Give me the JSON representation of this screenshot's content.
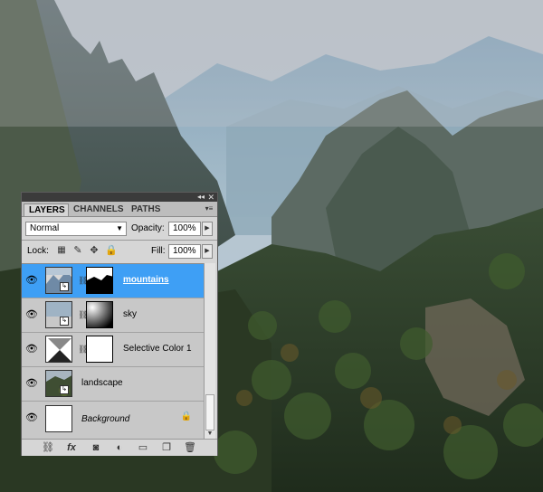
{
  "panel": {
    "tabs": [
      "LAYERS",
      "CHANNELS",
      "PATHS"
    ],
    "active_tab": "LAYERS",
    "collapse_icon": "double-chevron-icon",
    "close_icon": "close-icon",
    "menu_icon": "panel-menu-icon"
  },
  "controls": {
    "blend_mode": "Normal",
    "opacity_label": "Opacity:",
    "opacity_value": "100%",
    "lock_label": "Lock:",
    "fill_label": "Fill:",
    "fill_value": "100%"
  },
  "layers": [
    {
      "name": "mountains",
      "selected": true,
      "visible": true
    },
    {
      "name": "sky",
      "selected": false,
      "visible": true
    },
    {
      "name": "Selective Color 1",
      "selected": false,
      "visible": true
    },
    {
      "name": "landscape",
      "selected": false,
      "visible": true
    },
    {
      "name": "Background",
      "selected": false,
      "visible": true,
      "locked": true
    }
  ],
  "bottom_icons": [
    "link-layers-icon",
    "layer-style-icon",
    "add-mask-icon",
    "adjustment-layer-icon",
    "new-group-icon",
    "new-layer-icon",
    "trash-icon"
  ],
  "colors": {
    "selection": "#3e9ff5",
    "panel_bg": "#d6d6d6"
  }
}
